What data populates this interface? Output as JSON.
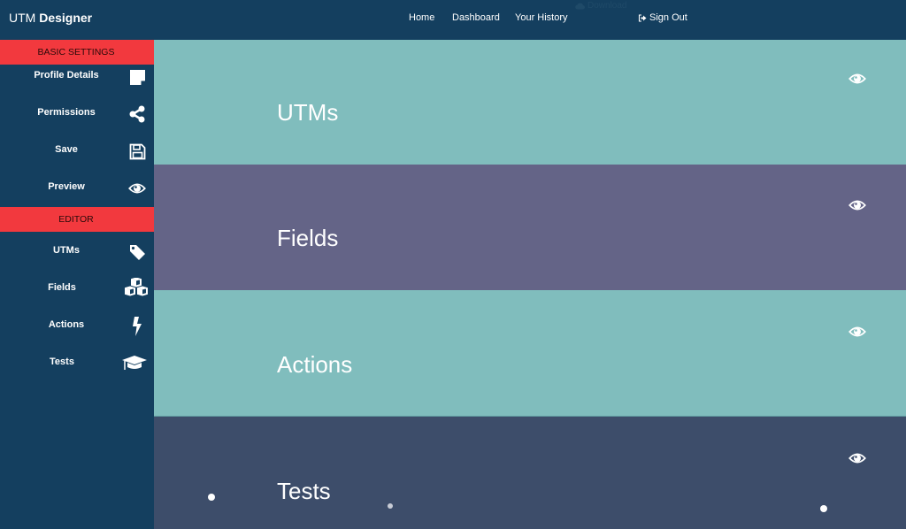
{
  "header": {
    "brand_light": "UTM",
    "brand_bold": "Designer",
    "nav": [
      {
        "label": "Home"
      },
      {
        "label": "Dashboard"
      },
      {
        "label": "Your History"
      }
    ],
    "download_label": "Download",
    "download_icon": "cloud-download-icon",
    "signout_label": "Sign Out",
    "signout_icon": "sign-out-icon"
  },
  "sidebar": {
    "sections": [
      {
        "title": "BASIC SETTINGS",
        "items": [
          {
            "label": "Profile Details",
            "icon": "sticky-note-icon"
          },
          {
            "label": "Permissions",
            "icon": "share-icon"
          },
          {
            "label": "Save",
            "icon": "floppy-disk-icon"
          },
          {
            "label": "Preview",
            "icon": "eye-icon"
          }
        ]
      },
      {
        "title": "EDITOR",
        "items": [
          {
            "label": "UTMs",
            "icon": "tag-icon"
          },
          {
            "label": "Fields",
            "icon": "cubes-icon"
          },
          {
            "label": "Actions",
            "icon": "bolt-icon"
          },
          {
            "label": "Tests",
            "icon": "graduation-cap-icon"
          }
        ]
      }
    ]
  },
  "main": {
    "panels": [
      {
        "title": "UTMs",
        "color": "#80bdbd",
        "icon": "eye-icon"
      },
      {
        "title": "Fields",
        "color": "#646487",
        "icon": "eye-icon"
      },
      {
        "title": "Actions",
        "color": "#80bdbd",
        "icon": "eye-icon"
      },
      {
        "title": "Tests",
        "color": "#3d4d6a",
        "icon": "eye-icon"
      }
    ]
  },
  "colors": {
    "navy": "#143f5f",
    "accent_red": "#f2393e",
    "teal": "#80bdbd",
    "purple": "#646487",
    "slate": "#3d4d6a"
  }
}
